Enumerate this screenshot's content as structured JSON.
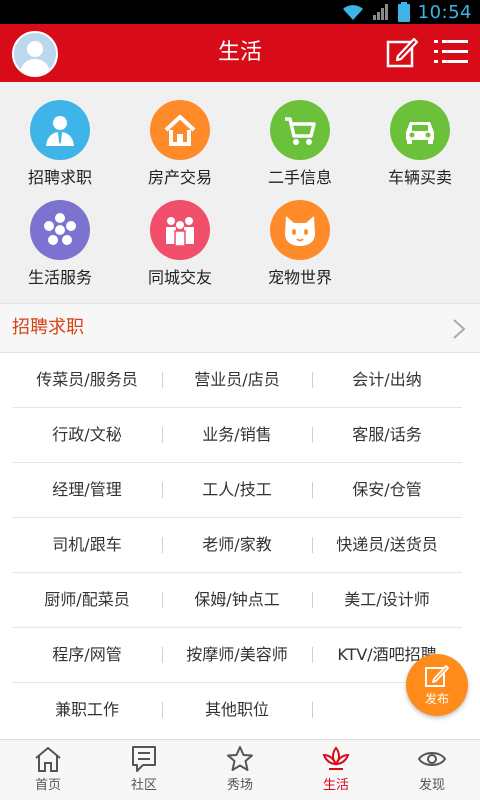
{
  "status_bar": {
    "time": "10:54"
  },
  "header": {
    "title": "生活"
  },
  "categories": [
    {
      "label": "招聘求职",
      "color": "#3fb4e8",
      "icon": "person-icon"
    },
    {
      "label": "房产交易",
      "color": "#ff8a2a",
      "icon": "house-icon"
    },
    {
      "label": "二手信息",
      "color": "#6cc13a",
      "icon": "cart-icon"
    },
    {
      "label": "车辆买卖",
      "color": "#6cc13a",
      "icon": "car-icon"
    },
    {
      "label": "生活服务",
      "color": "#7b73cf",
      "icon": "star-icon"
    },
    {
      "label": "同城交友",
      "color": "#f04e6a",
      "icon": "people-icon"
    },
    {
      "label": "宠物世界",
      "color": "#ff8a2a",
      "icon": "cat-icon"
    }
  ],
  "section": {
    "title": "招聘求职"
  },
  "jobs": [
    [
      "传菜员/服务员",
      "营业员/店员",
      "会计/出纳"
    ],
    [
      "行政/文秘",
      "业务/销售",
      "客服/话务"
    ],
    [
      "经理/管理",
      "工人/技工",
      "保安/仓管"
    ],
    [
      "司机/跟车",
      "老师/家教",
      "快递员/送货员"
    ],
    [
      "厨师/配菜员",
      "保姆/钟点工",
      "美工/设计师"
    ],
    [
      "程序/网管",
      "按摩师/美容师",
      "KTV/酒吧招聘"
    ],
    [
      "兼职工作",
      "其他职位",
      ""
    ]
  ],
  "fab": {
    "label": "发布"
  },
  "bottom_nav": [
    {
      "label": "首页",
      "icon": "home-icon",
      "active": false
    },
    {
      "label": "社区",
      "icon": "chat-icon",
      "active": false
    },
    {
      "label": "秀场",
      "icon": "star-outline-icon",
      "active": false
    },
    {
      "label": "生活",
      "icon": "lotus-icon",
      "active": true
    },
    {
      "label": "发现",
      "icon": "eye-icon",
      "active": false
    }
  ],
  "colors": {
    "brand_red": "#d80c18",
    "accent_orange": "#ff8c1a",
    "section_title": "#d84315"
  }
}
